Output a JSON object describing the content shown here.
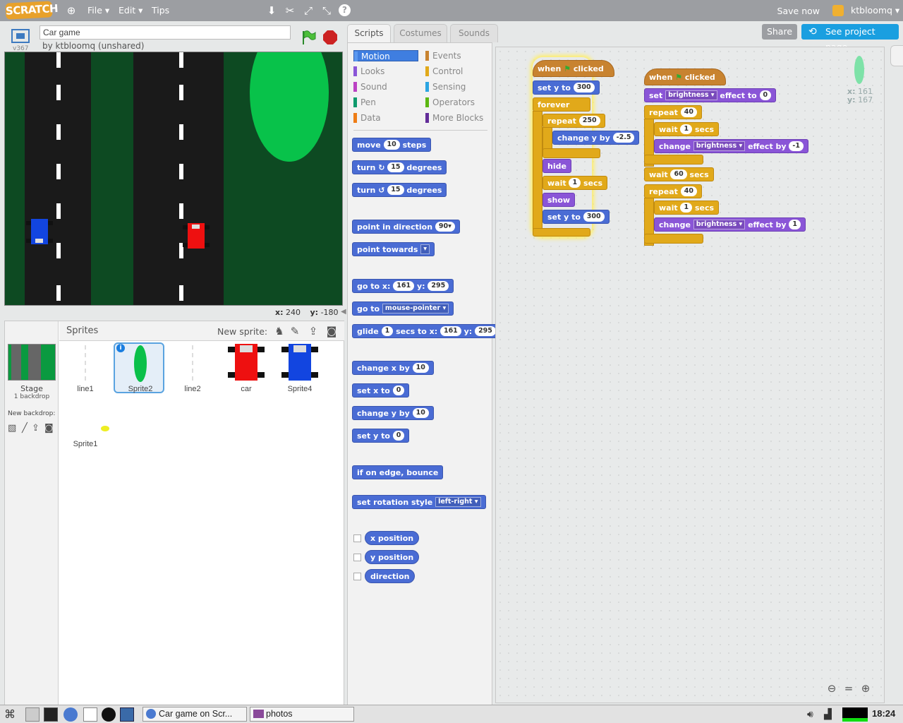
{
  "topbar": {
    "logo": "SCRATCH",
    "menu": [
      "File ▾",
      "Edit ▾",
      "Tips"
    ],
    "save_now": "Save now",
    "username": "ktbloomq ▾"
  },
  "stage": {
    "version": "v367",
    "project_title": "Car game",
    "author": "by ktbloomq (unshared)",
    "coords_x_label": "x:",
    "coords_x": "240",
    "coords_y_label": "y:",
    "coords_y": "-180"
  },
  "sprites": {
    "header": "Sprites",
    "new_sprite": "New sprite:",
    "stage_label": "Stage",
    "stage_sub": "1 backdrop",
    "new_backdrop": "New backdrop:",
    "items": [
      "line1",
      "Sprite2",
      "line2",
      "car",
      "Sprite4",
      "Sprite1"
    ]
  },
  "tabs": [
    "Scripts",
    "Costumes",
    "Sounds"
  ],
  "categories": {
    "left": [
      "Motion",
      "Looks",
      "Sound",
      "Pen",
      "Data"
    ],
    "right": [
      "Events",
      "Control",
      "Sensing",
      "Operators",
      "More Blocks"
    ],
    "colors": {
      "Motion": "#4a6cd4",
      "Looks": "#8a55d7",
      "Sound": "#bb42c3",
      "Pen": "#0e9a6c",
      "Data": "#ee7d16",
      "Events": "#c88330",
      "Control": "#e1a91a",
      "Sensing": "#2ca5e2",
      "Operators": "#5cb712",
      "More Blocks": "#632d99"
    }
  },
  "palette": {
    "move": [
      "move",
      "10",
      "steps"
    ],
    "turn_cw": [
      "turn",
      "15",
      "degrees"
    ],
    "turn_ccw": [
      "turn",
      "15",
      "degrees"
    ],
    "point_dir": [
      "point in direction",
      "90▾"
    ],
    "point_towards": [
      "point towards",
      "▾"
    ],
    "goto_xy": [
      "go to x:",
      "161",
      "y:",
      "295"
    ],
    "goto": [
      "go to",
      "mouse-pointer ▾"
    ],
    "glide": [
      "glide",
      "1",
      "secs to x:",
      "161",
      "y:",
      "295"
    ],
    "change_x": [
      "change x by",
      "10"
    ],
    "set_x": [
      "set x to",
      "0"
    ],
    "change_y": [
      "change y by",
      "10"
    ],
    "set_y": [
      "set y to",
      "0"
    ],
    "bounce": "if on edge, bounce",
    "rotation": [
      "set rotation style",
      "left-right ▾"
    ],
    "reporters": [
      "x position",
      "y position",
      "direction"
    ]
  },
  "script1": {
    "hat": [
      "when",
      "clicked"
    ],
    "set_y": [
      "set y to",
      "300"
    ],
    "forever": "forever",
    "repeat": [
      "repeat",
      "250"
    ],
    "change_y": [
      "change y by",
      "-2.5"
    ],
    "hide": "hide",
    "wait": [
      "wait",
      "1",
      "secs"
    ],
    "show": "show",
    "set_y2": [
      "set y to",
      "300"
    ]
  },
  "script2": {
    "hat": [
      "when",
      "clicked"
    ],
    "set_effect": [
      "set",
      "brightness ▾",
      "effect to",
      "0"
    ],
    "repeat1": [
      "repeat",
      "40"
    ],
    "wait1": [
      "wait",
      "1",
      "secs"
    ],
    "change1": [
      "change",
      "brightness ▾",
      "effect by",
      "-1"
    ],
    "wait60": [
      "wait",
      "60",
      "secs"
    ],
    "repeat2": [
      "repeat",
      "40"
    ],
    "wait2": [
      "wait",
      "1",
      "secs"
    ],
    "change2": [
      "change",
      "brightness ▾",
      "effect by",
      "1"
    ]
  },
  "sprite_info": {
    "x_label": "x:",
    "x": "161",
    "y_label": "y:",
    "y": "167"
  },
  "project_actions": {
    "share": "Share",
    "see_project": "See project page"
  },
  "taskbar": {
    "windows": [
      "Car game on Scr...",
      "photos"
    ],
    "clock": "18:24"
  }
}
